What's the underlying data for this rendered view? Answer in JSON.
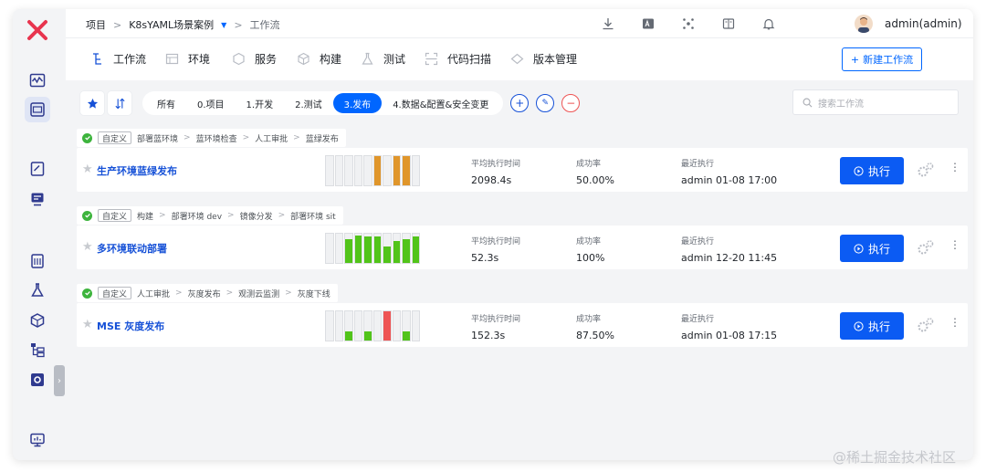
{
  "topbar": {
    "breadcrumb": {
      "root": "项目",
      "project": "K8sYAML场景案例",
      "current": "工作流"
    },
    "user": "admin(admin)",
    "icons": [
      "download-icon",
      "translate-icon",
      "plugin-icon",
      "docs-icon",
      "bell-icon"
    ]
  },
  "modules": {
    "tabs": [
      {
        "label": "工作流",
        "icon": "workflow-icon"
      },
      {
        "label": "环境",
        "icon": "environment-icon"
      },
      {
        "label": "服务",
        "icon": "service-icon"
      },
      {
        "label": "构建",
        "icon": "build-icon"
      },
      {
        "label": "测试",
        "icon": "test-icon"
      },
      {
        "label": "代码扫描",
        "icon": "scan-icon"
      },
      {
        "label": "版本管理",
        "icon": "version-icon"
      }
    ],
    "new_button": "新建工作流"
  },
  "filters": {
    "groups": [
      "所有",
      "0.项目",
      "1.开发",
      "2.测试",
      "3.发布",
      "4.数据&配置&安全变更"
    ],
    "active": "3.发布",
    "search_placeholder": "搜索工作流"
  },
  "workflows": [
    {
      "name": "生产环境蓝绿发布",
      "tag": "自定义",
      "stages": [
        "部署蓝环境",
        "蓝环境检查",
        "人工审批",
        "蓝绿发布"
      ],
      "avg_time_label": "平均执行时间",
      "avg_time": "2098.4s",
      "success_label": "成功率",
      "success": "50.00%",
      "recent_label": "最近执行",
      "recent": "admin 01-08 17:00",
      "run_label": "执行",
      "history": [
        {
          "status": "empty",
          "level": 0
        },
        {
          "status": "empty",
          "level": 0
        },
        {
          "status": "empty",
          "level": 0
        },
        {
          "status": "empty",
          "level": 0
        },
        {
          "status": "empty",
          "level": 0
        },
        {
          "status": "warning",
          "level": 1.0
        },
        {
          "status": "empty",
          "level": 0
        },
        {
          "status": "warning",
          "level": 1.0
        },
        {
          "status": "warning",
          "level": 1.0
        },
        {
          "status": "empty",
          "level": 0
        }
      ]
    },
    {
      "name": "多环境联动部署",
      "tag": "自定义",
      "stages": [
        "构建",
        "部署环境 dev",
        "镜像分发",
        "部署环境 sit"
      ],
      "avg_time_label": "平均执行时间",
      "avg_time": "52.3s",
      "success_label": "成功率",
      "success": "100%",
      "recent_label": "最近执行",
      "recent": "admin 12-20 11:45",
      "run_label": "执行",
      "history": [
        {
          "status": "empty",
          "level": 0
        },
        {
          "status": "empty",
          "level": 0
        },
        {
          "status": "success",
          "level": 0.8
        },
        {
          "status": "success",
          "level": 0.95
        },
        {
          "status": "success",
          "level": 0.9
        },
        {
          "status": "success",
          "level": 0.9
        },
        {
          "status": "success",
          "level": 0.55
        },
        {
          "status": "success",
          "level": 0.75
        },
        {
          "status": "success",
          "level": 0.8
        },
        {
          "status": "success",
          "level": 0.92
        }
      ]
    },
    {
      "name": "MSE 灰度发布",
      "tag": "自定义",
      "stages": [
        "人工审批",
        "灰度发布",
        "观测云监测",
        "灰度下线"
      ],
      "avg_time_label": "平均执行时间",
      "avg_time": "152.3s",
      "success_label": "成功率",
      "success": "87.50%",
      "recent_label": "最近执行",
      "recent": "admin 01-08 17:15",
      "run_label": "执行",
      "history": [
        {
          "status": "empty",
          "level": 0
        },
        {
          "status": "empty",
          "level": 0
        },
        {
          "status": "success",
          "level": 0.3
        },
        {
          "status": "empty",
          "level": 0
        },
        {
          "status": "success",
          "level": 0.3
        },
        {
          "status": "empty",
          "level": 0
        },
        {
          "status": "failed",
          "level": 1.0
        },
        {
          "status": "empty",
          "level": 0
        },
        {
          "status": "success",
          "level": 0.3
        },
        {
          "status": "empty",
          "level": 0
        }
      ]
    }
  ],
  "colors": {
    "accent": "#0066ff",
    "success": "#52c41a",
    "warning": "#e0962b",
    "failed": "#ee5454"
  },
  "watermark": "@稀土掘金技术社区"
}
